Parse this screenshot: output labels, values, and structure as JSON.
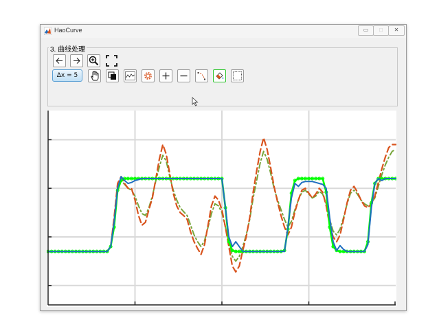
{
  "window": {
    "title": "HaoCurve",
    "min_label": "▭",
    "max_label": "□",
    "close_label": "✕"
  },
  "panel": {
    "title": "3. 曲线处理"
  },
  "toolbar": {
    "row1": [
      "arrow-left-icon",
      "arrow-right-icon",
      "zoom-in-icon",
      "fit-screen-icon"
    ],
    "dx_label": "Δx = 5",
    "row2": [
      "hand-pan-icon",
      "layers-icon",
      "line-chart-icon",
      "gear-icon",
      "plus-icon",
      "minus-icon",
      "curve-edit-icon",
      "fill-bucket-icon",
      "rectangle-select-icon"
    ]
  },
  "colors": {
    "blue_curve": "#1f6fc0",
    "orange_curve": "#d9541e",
    "olive_curve": "#77a53a",
    "green_curve": "#00ff00",
    "grid": "#d9d9d9",
    "accent": "#5a9fd4"
  },
  "chart_data": {
    "type": "line",
    "grid": true,
    "tick_labels_shown": false,
    "ylim": [
      -0.2,
      1.8
    ],
    "series": [
      {
        "color": "#1f6fc0",
        "style": "solid",
        "x": [
          0,
          1,
          2,
          3,
          4,
          5,
          6,
          7,
          8,
          9,
          10,
          11,
          12,
          13,
          14,
          15,
          16,
          17,
          18,
          19,
          20,
          21,
          22,
          23,
          24,
          25,
          26,
          27,
          28,
          29,
          30,
          31,
          32,
          33,
          34,
          35,
          36,
          37,
          38,
          39,
          40,
          41,
          42,
          43,
          44,
          45,
          46,
          47,
          48,
          49,
          50,
          51,
          52,
          53,
          54,
          55,
          56,
          57,
          58,
          59,
          60,
          61,
          62,
          63,
          64,
          65,
          66,
          67,
          68,
          69,
          70,
          71,
          72,
          73,
          74,
          75,
          76,
          77,
          78,
          79,
          80,
          81,
          82,
          83,
          84,
          85,
          86,
          87,
          88,
          89,
          90,
          91,
          92,
          93,
          94,
          95,
          96,
          97,
          98,
          99,
          100
        ],
        "y": [
          0.35,
          0.35,
          0.35,
          0.35,
          0.35,
          0.35,
          0.35,
          0.35,
          0.35,
          0.35,
          0.35,
          0.35,
          0.35,
          0.35,
          0.35,
          0.35,
          0.35,
          0.35,
          0.4,
          0.65,
          1.0,
          1.12,
          1.08,
          1.05,
          1.06,
          1.08,
          1.09,
          1.1,
          1.1,
          1.1,
          1.1,
          1.1,
          1.1,
          1.1,
          1.1,
          1.1,
          1.1,
          1.1,
          1.1,
          1.1,
          1.1,
          1.1,
          1.1,
          1.1,
          1.1,
          1.1,
          1.1,
          1.1,
          1.1,
          1.1,
          1.1,
          0.8,
          0.5,
          0.4,
          0.45,
          0.4,
          0.35,
          0.35,
          0.35,
          0.35,
          0.35,
          0.35,
          0.35,
          0.35,
          0.35,
          0.35,
          0.35,
          0.35,
          0.35,
          0.6,
          0.9,
          1.05,
          1.02,
          1.06,
          1.07,
          1.07,
          1.07,
          1.06,
          1.05,
          1.04,
          1.0,
          0.7,
          0.45,
          0.36,
          0.41,
          0.37,
          0.35,
          0.35,
          0.35,
          0.35,
          0.35,
          0.35,
          0.42,
          0.8,
          1.05,
          1.1,
          1.08,
          1.1,
          1.1,
          1.1,
          1.1
        ]
      },
      {
        "color": "#d9541e",
        "style": "dashed",
        "x": [
          0,
          1,
          2,
          3,
          4,
          5,
          6,
          7,
          8,
          9,
          10,
          11,
          12,
          13,
          14,
          15,
          16,
          17,
          18,
          19,
          20,
          21,
          22,
          23,
          24,
          25,
          26,
          27,
          28,
          29,
          30,
          31,
          32,
          33,
          34,
          35,
          36,
          37,
          38,
          39,
          40,
          41,
          42,
          43,
          44,
          45,
          46,
          47,
          48,
          49,
          50,
          51,
          52,
          53,
          54,
          55,
          56,
          57,
          58,
          59,
          60,
          61,
          62,
          63,
          64,
          65,
          66,
          67,
          68,
          69,
          70,
          71,
          72,
          73,
          74,
          75,
          76,
          77,
          78,
          79,
          80,
          81,
          82,
          83,
          84,
          85,
          86,
          87,
          88,
          89,
          90,
          91,
          92,
          93,
          94,
          95,
          96,
          97,
          98,
          99,
          100
        ],
        "y": [
          0.35,
          0.35,
          0.35,
          0.35,
          0.35,
          0.35,
          0.35,
          0.35,
          0.35,
          0.35,
          0.35,
          0.35,
          0.35,
          0.35,
          0.35,
          0.35,
          0.35,
          0.35,
          0.4,
          0.7,
          1.05,
          1.12,
          1.05,
          1.0,
          1.0,
          0.88,
          0.72,
          0.62,
          0.65,
          0.78,
          0.9,
          1.1,
          1.3,
          1.45,
          1.35,
          1.15,
          0.95,
          0.82,
          0.75,
          0.72,
          0.68,
          0.55,
          0.45,
          0.38,
          0.32,
          0.42,
          0.62,
          0.82,
          0.92,
          0.88,
          0.78,
          0.6,
          0.4,
          0.2,
          0.14,
          0.2,
          0.36,
          0.5,
          0.7,
          0.96,
          1.18,
          1.38,
          1.52,
          1.4,
          1.22,
          1.02,
          0.86,
          0.72,
          0.6,
          0.52,
          0.6,
          0.76,
          0.88,
          0.98,
          1.0,
          0.95,
          0.9,
          0.94,
          1.0,
          0.96,
          0.82,
          0.62,
          0.5,
          0.45,
          0.52,
          0.68,
          0.85,
          0.98,
          1.02,
          0.96,
          0.88,
          0.82,
          0.8,
          0.84,
          0.92,
          1.06,
          1.2,
          1.32,
          1.42,
          1.45,
          1.45
        ]
      },
      {
        "color": "#77a53a",
        "style": "dashdot",
        "x": [
          0,
          1,
          2,
          3,
          4,
          5,
          6,
          7,
          8,
          9,
          10,
          11,
          12,
          13,
          14,
          15,
          16,
          17,
          18,
          19,
          20,
          21,
          22,
          23,
          24,
          25,
          26,
          27,
          28,
          29,
          30,
          31,
          32,
          33,
          34,
          35,
          36,
          37,
          38,
          39,
          40,
          41,
          42,
          43,
          44,
          45,
          46,
          47,
          48,
          49,
          50,
          51,
          52,
          53,
          54,
          55,
          56,
          57,
          58,
          59,
          60,
          61,
          62,
          63,
          64,
          65,
          66,
          67,
          68,
          69,
          70,
          71,
          72,
          73,
          74,
          75,
          76,
          77,
          78,
          79,
          80,
          81,
          82,
          83,
          84,
          85,
          86,
          87,
          88,
          89,
          90,
          91,
          92,
          93,
          94,
          95,
          96,
          97,
          98,
          99,
          100
        ],
        "y": [
          0.35,
          0.35,
          0.35,
          0.35,
          0.35,
          0.35,
          0.35,
          0.35,
          0.35,
          0.35,
          0.35,
          0.35,
          0.35,
          0.35,
          0.35,
          0.35,
          0.35,
          0.35,
          0.4,
          0.68,
          1.02,
          1.08,
          1.04,
          1.0,
          0.98,
          0.92,
          0.82,
          0.74,
          0.72,
          0.8,
          0.92,
          1.08,
          1.22,
          1.34,
          1.28,
          1.12,
          0.98,
          0.88,
          0.8,
          0.76,
          0.72,
          0.62,
          0.52,
          0.45,
          0.4,
          0.46,
          0.6,
          0.74,
          0.84,
          0.82,
          0.75,
          0.6,
          0.45,
          0.3,
          0.25,
          0.3,
          0.4,
          0.52,
          0.68,
          0.9,
          1.08,
          1.26,
          1.38,
          1.3,
          1.16,
          1.0,
          0.88,
          0.78,
          0.68,
          0.6,
          0.66,
          0.78,
          0.88,
          0.96,
          0.98,
          0.94,
          0.9,
          0.92,
          0.97,
          0.94,
          0.84,
          0.68,
          0.56,
          0.52,
          0.58,
          0.7,
          0.84,
          0.95,
          0.98,
          0.94,
          0.88,
          0.84,
          0.82,
          0.85,
          0.9,
          1.02,
          1.14,
          1.24,
          1.32,
          1.38,
          1.4
        ]
      },
      {
        "color": "#00ff00",
        "style": "solid-markers",
        "x": [
          0,
          1,
          2,
          3,
          4,
          5,
          6,
          7,
          8,
          9,
          10,
          11,
          12,
          13,
          14,
          15,
          16,
          17,
          18,
          19,
          20,
          21,
          22,
          23,
          24,
          25,
          26,
          27,
          28,
          29,
          30,
          31,
          32,
          33,
          34,
          35,
          36,
          37,
          38,
          39,
          40,
          41,
          42,
          43,
          44,
          45,
          46,
          47,
          48,
          49,
          50,
          51,
          52,
          53,
          54,
          55,
          56,
          57,
          58,
          59,
          60,
          61,
          62,
          63,
          64,
          65,
          66,
          67,
          68,
          69,
          70,
          71,
          72,
          73,
          74,
          75,
          76,
          77,
          78,
          79,
          80,
          81,
          82,
          83,
          84,
          85,
          86,
          87,
          88,
          89,
          90,
          91,
          92,
          93,
          94,
          95,
          96,
          97,
          98,
          99,
          100
        ],
        "y": [
          0.35,
          0.35,
          0.35,
          0.35,
          0.35,
          0.35,
          0.35,
          0.35,
          0.35,
          0.35,
          0.35,
          0.35,
          0.35,
          0.35,
          0.35,
          0.35,
          0.35,
          0.35,
          0.4,
          0.6,
          0.98,
          1.08,
          1.1,
          1.1,
          1.1,
          1.1,
          1.1,
          1.1,
          1.1,
          1.1,
          1.1,
          1.1,
          1.1,
          1.1,
          1.1,
          1.1,
          1.1,
          1.1,
          1.1,
          1.1,
          1.1,
          1.1,
          1.1,
          1.1,
          1.1,
          1.1,
          1.1,
          1.1,
          1.1,
          1.1,
          1.1,
          0.8,
          0.45,
          0.36,
          0.35,
          0.35,
          0.35,
          0.35,
          0.35,
          0.35,
          0.35,
          0.35,
          0.35,
          0.35,
          0.35,
          0.35,
          0.35,
          0.35,
          0.36,
          0.58,
          0.95,
          1.08,
          1.1,
          1.1,
          1.1,
          1.1,
          1.1,
          1.1,
          1.1,
          1.1,
          0.96,
          0.6,
          0.4,
          0.36,
          0.35,
          0.35,
          0.35,
          0.35,
          0.35,
          0.35,
          0.35,
          0.35,
          0.45,
          0.85,
          1.05,
          1.1,
          1.1,
          1.1,
          1.1,
          1.1,
          1.1
        ]
      }
    ]
  }
}
